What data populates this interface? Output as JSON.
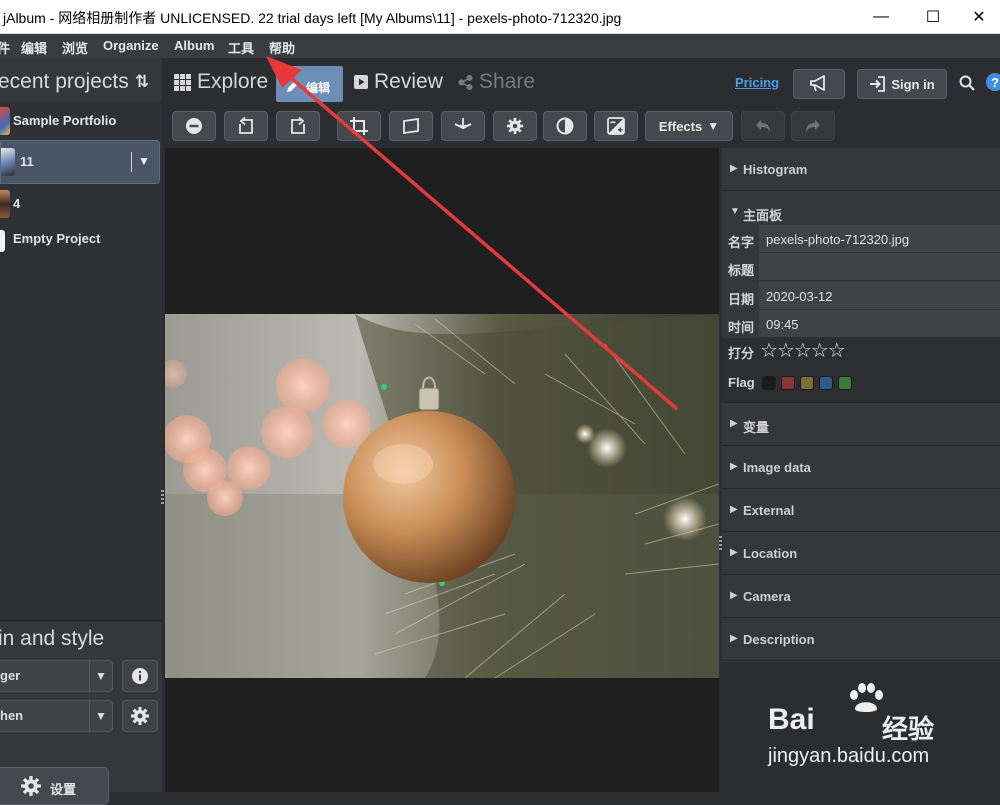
{
  "window": {
    "title": "jAlbum - 网络相册制作者 UNLICENSED. 22 trial days left [My Albums\\11] - pexels-photo-712320.jpg",
    "minimize": "—",
    "maximize": "☐",
    "close": "✕"
  },
  "menu": {
    "items": [
      "件",
      "编辑",
      "浏览",
      "Organize",
      "Album",
      "工具",
      "帮助"
    ]
  },
  "left": {
    "title": "ecent projects",
    "sort_icon": "⇅",
    "projects": [
      "Sample Portfolio",
      "11",
      "4",
      "Empty Project"
    ],
    "selected_caret": "▼",
    "skin_title": "in and style",
    "skin_value": "ger",
    "style_value": "hen",
    "caret": "▼",
    "settings_label": "设置"
  },
  "nav": {
    "explore": "Explore",
    "edit": "编辑",
    "review": "Review",
    "share": "Share",
    "pricing": "Pricing",
    "signin": "Sign in"
  },
  "toolbar": {
    "effects": "Effects",
    "effects_caret": "▼"
  },
  "right": {
    "histogram": "Histogram",
    "main_panel": "主面板",
    "fields": {
      "name_label": "名字",
      "name_value": "pexels-photo-712320.jpg",
      "title_label": "标题",
      "title_value": "",
      "date_label": "日期",
      "date_value": "2020-03-12",
      "time_label": "时间",
      "time_value": "09:45",
      "rating_label": "打分",
      "rating_stars": "☆☆☆☆☆",
      "rating": 0,
      "flag_label": "Flag"
    },
    "flag_colors": [
      "#1b1b1b",
      "#8a3434",
      "#7d6e34",
      "#2e5c86",
      "#3b7a3b"
    ],
    "sections": [
      "变量",
      "Image data",
      "External",
      "Location",
      "Camera",
      "Description"
    ]
  },
  "watermark": {
    "brand": "Bai",
    "brand_cn": "经验",
    "url": "jingyan.baidu.com"
  },
  "colors": {
    "accent_tab": "#6d8eb6",
    "link": "#4a9fe8",
    "arrow": "#e8393a"
  }
}
